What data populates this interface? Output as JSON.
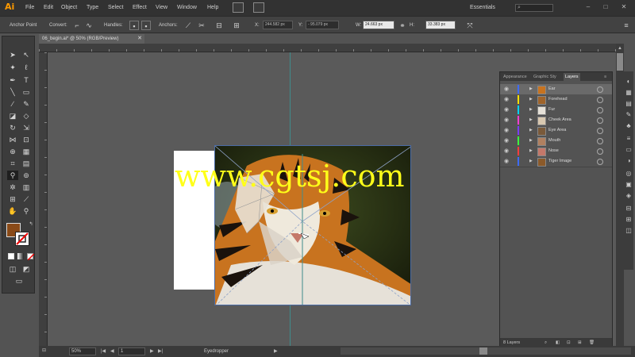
{
  "app": {
    "logo": "Ai"
  },
  "menu": [
    "File",
    "Edit",
    "Object",
    "Type",
    "Select",
    "Effect",
    "View",
    "Window",
    "Help"
  ],
  "workspace": "Essentials",
  "control_bar": {
    "anchor_point": "Anchor Point",
    "convert": "Convert:",
    "handles": "Handles:",
    "anchors": "Anchors:",
    "x_label": "X:",
    "x_value": "244.582 px",
    "y_label": "Y:",
    "y_value": "- 95.079 px",
    "w_label": "W:",
    "w_value": "24.663 px",
    "h_label": "H:",
    "h_value": "33.383 px"
  },
  "document": {
    "tab_label": "06_begin.ai* @ 50% (RGB/Preview)"
  },
  "watermark": "www.cgtsj.com",
  "layers_panel": {
    "tabs": [
      "Appearance",
      "Graphic Sty",
      "Layers"
    ],
    "layers": [
      {
        "name": "Ear",
        "color": "#3d6bff",
        "selected": true
      },
      {
        "name": "Forehead",
        "color": "#ffe100",
        "selected": false
      },
      {
        "name": "Fur",
        "color": "#00d2ff",
        "selected": false
      },
      {
        "name": "Cheek Area",
        "color": "#ff3dd2",
        "selected": false
      },
      {
        "name": "Eye Area",
        "color": "#7a3dff",
        "selected": false
      },
      {
        "name": "Mouth",
        "color": "#3dff3d",
        "selected": false
      },
      {
        "name": "Nose",
        "color": "#ff3d3d",
        "selected": false
      },
      {
        "name": "Tiger Image",
        "color": "#3d6bff",
        "selected": false
      }
    ],
    "footer": "8 Layers"
  },
  "status_bar": {
    "zoom": "50%",
    "page": "1",
    "tool": "Eyedropper"
  },
  "colors": {
    "accent_logo": "#ff9a00",
    "fill_swatch": "#8a4a17",
    "watermark": "#ffff19"
  }
}
